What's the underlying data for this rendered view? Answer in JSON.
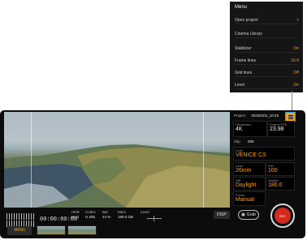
{
  "menu": {
    "title": "Menu",
    "items": [
      {
        "label": "Open project",
        "value": ">"
      },
      {
        "label": "Cinema Library",
        "value": ""
      },
      {
        "label": "Stabilizer",
        "value": "On"
      },
      {
        "label": "Frame lines",
        "value": "16:9"
      },
      {
        "label": "Grid lines",
        "value": "Off"
      },
      {
        "label": "Level",
        "value": "On"
      }
    ]
  },
  "panel": {
    "project_label": "Project",
    "project_name": "20220101_10:33",
    "resolution_label": "Resolution",
    "resolution": "4K",
    "fps_label": "Project FPS",
    "fps": "23.98",
    "clip_label": "Clip",
    "clip": "000",
    "look_label": "Look",
    "look": "VENICE CS",
    "lens_label": "Lens",
    "lens": "26mm",
    "iso_label": "ISO",
    "iso": "100",
    "wb_label": "WB",
    "wb": "Daylight",
    "shutter_label": "Shutter",
    "shutter": "180.0",
    "focus_label": "Focus",
    "focus": "Manual"
  },
  "bottom": {
    "timecode": "00:00:00:00",
    "stats": [
      {
        "label": "HDR",
        "value": "HLG"
      },
      {
        "label": "Codec",
        "value": "H.265"
      },
      {
        "label": "Bat",
        "value": "44 %"
      },
      {
        "label": "Mem",
        "value": "189.0 GB"
      }
    ],
    "level_label": "Level",
    "disp_label": "DISP",
    "sdr_label": "4Kfilm",
    "grab_label": "Grab",
    "rec_label": "REC"
  },
  "colors": {
    "accent": "#f0a020",
    "record": "#d22a1c",
    "callout": "#2aa5dd"
  }
}
